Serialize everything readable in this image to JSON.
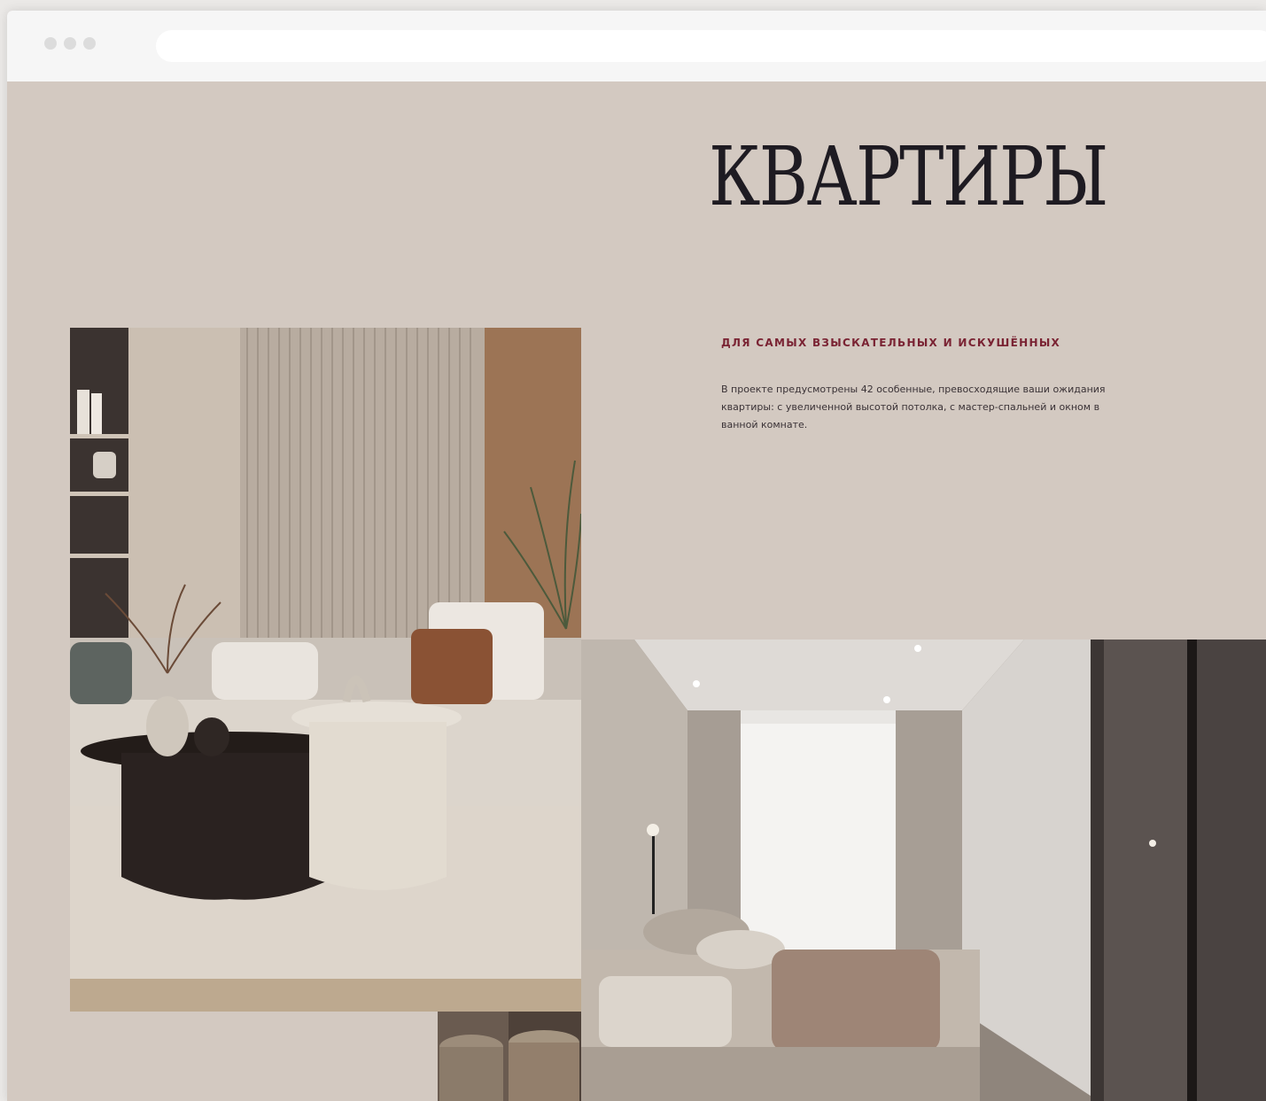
{
  "page": {
    "title": "КВАРТИРЫ",
    "subtitle": "для самых взыскательных и искушённых",
    "description": "В проекте предусмотрены 42 особенные, превосходящие ваши ожидания квартиры: с увеличенной высотой потолка, с мастер-спальней и окном в ванной комнате."
  },
  "colors": {
    "background": "#d3c9c1",
    "title": "#1e1b22",
    "accent": "#7a2333"
  },
  "images": {
    "living_room": "living-room-photo",
    "bedroom": "bedroom-photo",
    "detail": "interior-detail-photo"
  }
}
